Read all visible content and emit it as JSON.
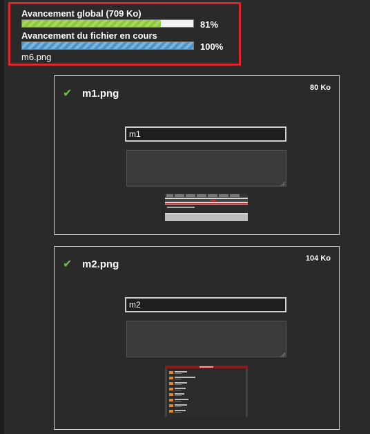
{
  "upload_progress": {
    "global_label": "Avancement global (709 Ko)",
    "global_percent_label": "81%",
    "global_percent_value": 81,
    "file_label": "Avancement du fichier en cours",
    "file_percent_label": "100%",
    "file_percent_value": 100,
    "current_file": "m6.png"
  },
  "files": [
    {
      "name": "m1.png",
      "size": "80 Ko",
      "title_value": "m1",
      "description": ""
    },
    {
      "name": "m2.png",
      "size": "104 Ko",
      "title_value": "m2",
      "description": ""
    }
  ],
  "colors": {
    "highlight_border": "#e0262b",
    "global_bar": "#8dc63f",
    "file_bar": "#4b94c9",
    "check": "#6fbf4a"
  },
  "icons": {
    "uploaded": "checkmark-icon"
  }
}
